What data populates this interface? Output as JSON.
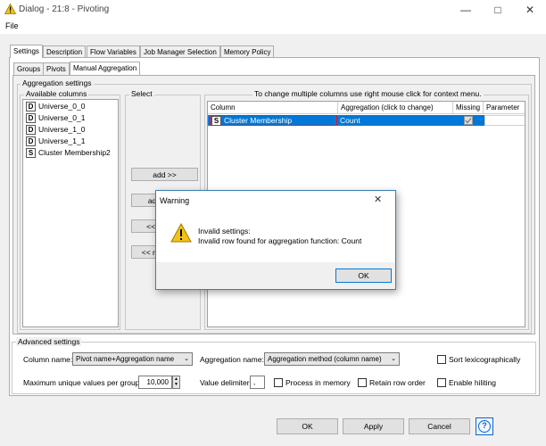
{
  "window": {
    "title": "Dialog - 21:8 - Pivoting",
    "warning_icon": "warning-triangle-icon"
  },
  "menu": {
    "file": "File"
  },
  "top_tabs": [
    "Settings",
    "Description",
    "Flow Variables",
    "Job Manager Selection",
    "Memory Policy"
  ],
  "sub_tabs": [
    "Groups",
    "Pivots",
    "Manual Aggregation"
  ],
  "aggregation_settings": {
    "legend": "Aggregation settings",
    "available_columns_legend": "Available columns",
    "select_legend": "Select",
    "hint": "To change multiple columns use right mouse click for context menu.",
    "available_columns": [
      {
        "type": "D",
        "name": "Universe_0_0"
      },
      {
        "type": "D",
        "name": "Universe_0_1"
      },
      {
        "type": "D",
        "name": "Universe_1_0"
      },
      {
        "type": "D",
        "name": "Universe_1_1"
      },
      {
        "type": "S",
        "name": "Cluster Membership2"
      }
    ],
    "buttons": {
      "add": "add >>",
      "add_all": "add all >>",
      "remove": "<< remove",
      "remove_all": "<< remove all"
    },
    "table_headers": [
      "Column",
      "Aggregation (click to change)",
      "Missing",
      "Parameter"
    ],
    "rows": [
      {
        "type": "S",
        "column": "Cluster Membership",
        "aggregation": "Count",
        "missing": true,
        "parameter": ""
      }
    ]
  },
  "dialog": {
    "title": "Warning",
    "line1": "Invalid settings:",
    "line2": "Invalid row found for aggregation function: Count",
    "ok": "OK"
  },
  "advanced": {
    "legend": "Advanced settings",
    "column_name_label": "Column name:",
    "column_name_value": "Pivot name+Aggregation name",
    "aggregation_name_label": "Aggregation name:",
    "aggregation_name_value": "Aggregation method (column name)",
    "sort_label": "Sort lexicographically",
    "max_unique_label": "Maximum unique values per group",
    "max_unique_value": "10,000",
    "value_delimiter_label": "Value delimiter",
    "value_delimiter_value": ",",
    "process_in_memory_label": "Process in memory",
    "retain_row_order_label": "Retain row order",
    "enable_hiliting_label": "Enable hiliting"
  },
  "footer": {
    "ok": "OK",
    "apply": "Apply",
    "cancel": "Cancel",
    "help": "?"
  }
}
